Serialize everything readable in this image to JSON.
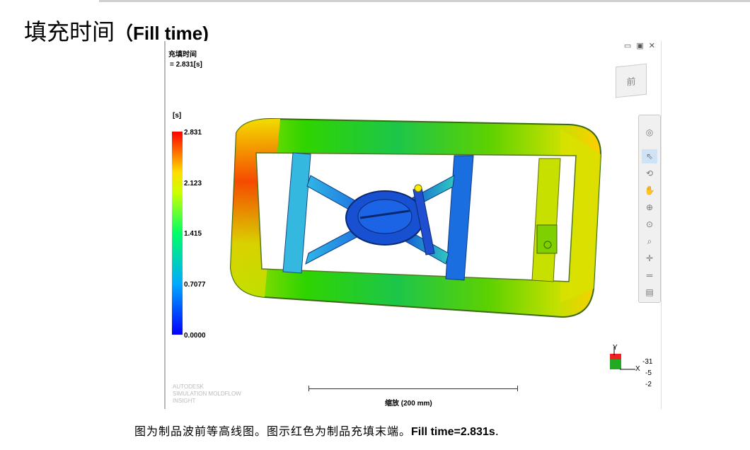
{
  "slide": {
    "title_cn": "填充时间",
    "title_en": "（Fill time)",
    "caption_cn": "图为制品波前等高线图。图示红色为制品充填末端。",
    "caption_en": "Fill time=2.831s",
    "caption_end": "."
  },
  "viewer": {
    "result_name": "充填时间",
    "result_value": "= 2.831[s]",
    "unit": "[s]",
    "window_controls": "▭ ▣ ✕",
    "viewcube_label": "前",
    "legend_ticks": [
      "2.831",
      "2.123",
      "1.415",
      "0.7077",
      "0.0000"
    ],
    "legend_colors": {
      "max": "#ff0000",
      "min": "#0000ff"
    },
    "brand_lines": [
      "AUTODESK",
      "SIMULATION MOLDFLOW",
      "INSIGHT"
    ],
    "scale_label": "缩放 (200 mm)",
    "triad": {
      "axis_y": "Y",
      "axis_x": "X",
      "rot1": "-31",
      "rot2": "-5",
      "rot3": "-2"
    },
    "toolbar": [
      {
        "name": "orbit-ring-icon",
        "glyph": "◎"
      },
      {
        "name": "select-pointer-icon",
        "glyph": "⇖"
      },
      {
        "name": "rotate-icon",
        "glyph": "⟲"
      },
      {
        "name": "pan-hand-icon",
        "glyph": "✋"
      },
      {
        "name": "zoom-icon",
        "glyph": "⊕"
      },
      {
        "name": "zoom-window-icon",
        "glyph": "⊙"
      },
      {
        "name": "zoom-fit-icon",
        "glyph": "⌕"
      },
      {
        "name": "center-icon",
        "glyph": "✛"
      },
      {
        "name": "measure-icon",
        "glyph": "═"
      },
      {
        "name": "clip-plane-icon",
        "glyph": "▤"
      }
    ]
  }
}
